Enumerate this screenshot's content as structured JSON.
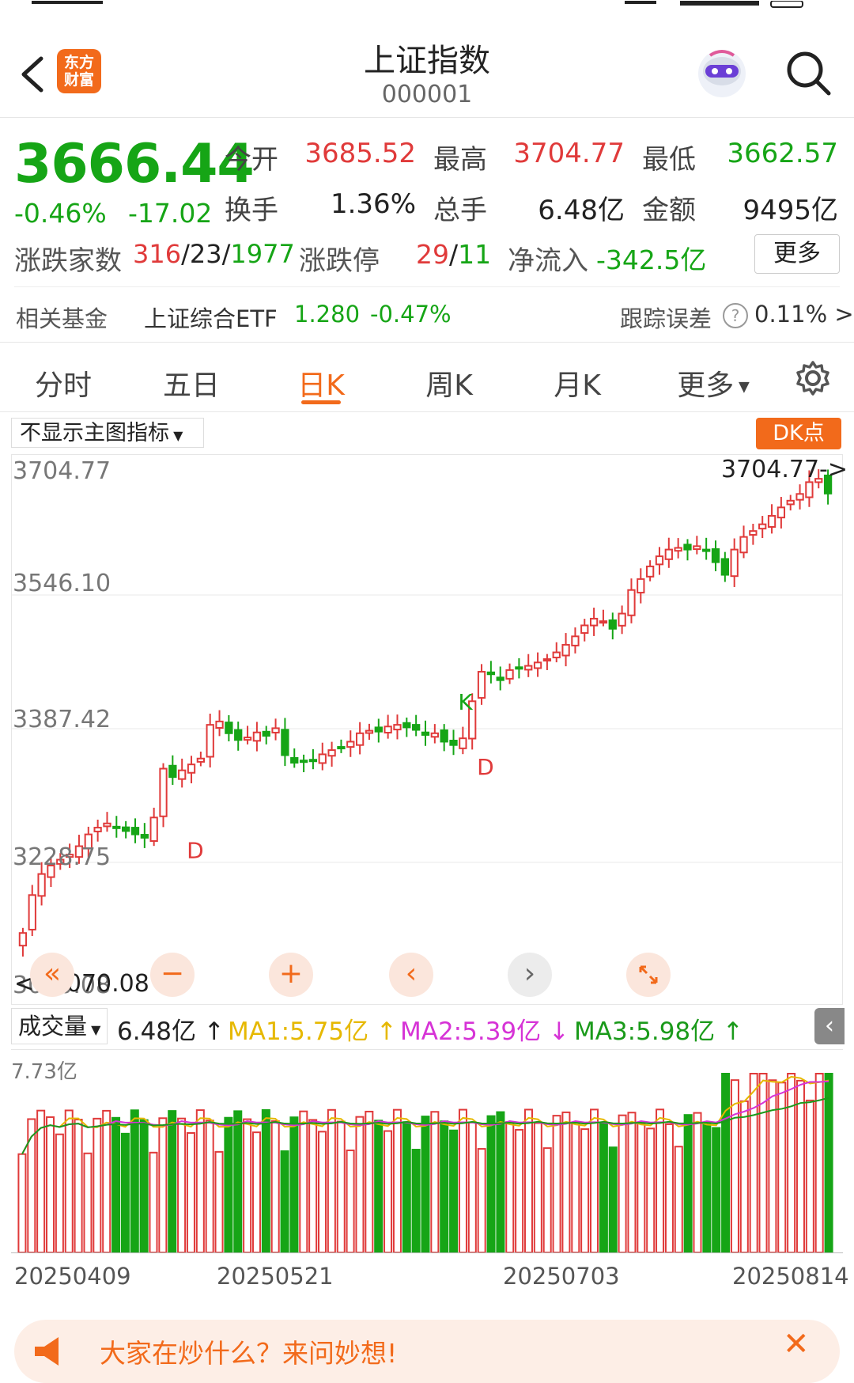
{
  "header": {
    "title": "上证指数",
    "code": "000001",
    "logo_text": [
      "东方",
      "财富"
    ]
  },
  "quote": {
    "price": "3666.44",
    "change_pct": "-0.46%",
    "change": "-17.02",
    "open_label": "今开",
    "open": "3685.52",
    "high_label": "最高",
    "high": "3704.77",
    "low_label": "最低",
    "low": "3662.57",
    "turnover_label": "换手",
    "turnover": "1.36%",
    "volume_label": "总手",
    "volume": "6.48亿",
    "amount_label": "金额",
    "amount": "9495亿",
    "breadth_label": "涨跌家数",
    "breadth_up": "316",
    "breadth_flat": "23",
    "breadth_down": "1977",
    "limit_label": "涨跌停",
    "limit_up": "29",
    "limit_down": "11",
    "netflow_label": "净流入",
    "netflow": "-342.5亿",
    "more_label": "更多"
  },
  "fund": {
    "label": "相关基金",
    "name": "上证综合ETF",
    "price": "1.280",
    "change_pct": "-0.47%",
    "tracking_label": "跟踪误差",
    "tracking_value": "0.11% >"
  },
  "tabs": [
    "分时",
    "五日",
    "日K",
    "周K",
    "月K",
    "更多"
  ],
  "active_tab": "日K",
  "chart": {
    "indicator_select": "不显示主图指标",
    "dk_button": "DK点",
    "y_labels": [
      "3704.77",
      "3546.10",
      "3387.42",
      "3228.75",
      "3070.08"
    ],
    "max_marker": "3704.77->",
    "min_marker": "<--3070.08",
    "volume_select": "成交量",
    "volume_value": "6.48亿",
    "ma1": "MA1:5.75亿",
    "ma2": "MA2:5.39亿",
    "ma3": "MA3:5.98亿",
    "vol_max": "7.73亿",
    "dates": [
      "20250409",
      "20250521",
      "20250703",
      "20250814"
    ],
    "markers": [
      {
        "text": "D",
        "color": "#e03a3a"
      },
      {
        "text": "K",
        "color": "#16a516"
      },
      {
        "text": "D",
        "color": "#e03a3a"
      }
    ],
    "colors": {
      "up": "#e03a3a",
      "down": "#16a516",
      "ma1": "#e6b800",
      "ma2": "#d633d6",
      "ma3": "#1a9a1a",
      "accent": "#f26a1b"
    }
  },
  "chart_data": {
    "type": "candlestick",
    "ylim": [
      3070.08,
      3704.77
    ],
    "closes": [
      3145,
      3190,
      3215,
      3225,
      3232,
      3238,
      3248,
      3262,
      3270,
      3275,
      3271,
      3266,
      3262,
      3258,
      3282,
      3340,
      3330,
      3338,
      3345,
      3352,
      3392,
      3396,
      3382,
      3374,
      3377,
      3383,
      3379,
      3388,
      3356,
      3347,
      3348,
      3350,
      3357,
      3362,
      3365,
      3372,
      3382,
      3385,
      3384,
      3390,
      3392,
      3389,
      3386,
      3380,
      3382,
      3372,
      3368,
      3376,
      3420,
      3455,
      3452,
      3445,
      3457,
      3460,
      3462,
      3466,
      3470,
      3478,
      3487,
      3497,
      3510,
      3518,
      3515,
      3506,
      3524,
      3552,
      3565,
      3580,
      3592,
      3600,
      3602,
      3600,
      3604,
      3600,
      3585,
      3570,
      3600,
      3615,
      3622,
      3630,
      3640,
      3650,
      3658,
      3666,
      3680,
      3684,
      3666.44
    ]
  }
}
